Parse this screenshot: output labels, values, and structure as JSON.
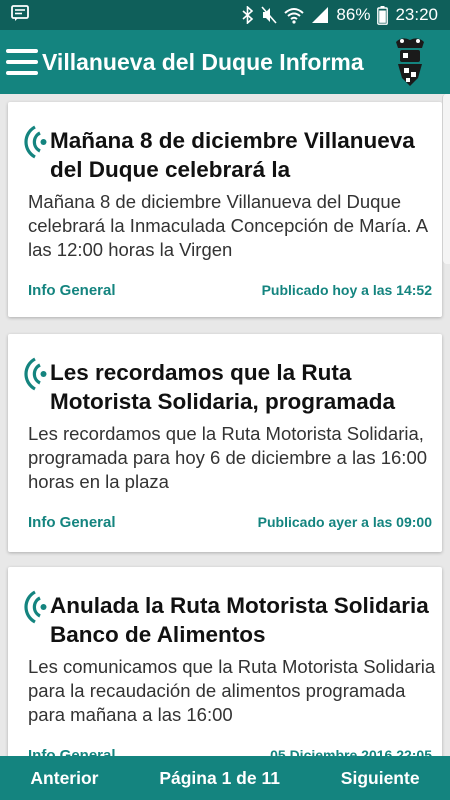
{
  "status_bar": {
    "battery": "86%",
    "time": "23:20"
  },
  "app_bar": {
    "title": "Villanueva del Duque Informa"
  },
  "posts": [
    {
      "title": "Mañana 8 de diciembre Villanueva del Duque celebrará la",
      "body": "Mañana 8 de diciembre Villanueva del Duque celebrará la Inmaculada Concepción de María. A las 12:00 horas la Virgen",
      "category": "Info General",
      "published": "Publicado hoy a las 14:52"
    },
    {
      "title": "Les recordamos que la Ruta Motorista Solidaria, programada",
      "body": "Les recordamos que la Ruta Motorista Solidaria, programada para hoy 6 de diciembre a las 16:00 horas en la plaza",
      "category": "Info General",
      "published": "Publicado ayer a las 09:00"
    },
    {
      "title": "Anulada la Ruta Motorista Solidaria Banco de Alimentos",
      "body": "Les comunicamos que la Ruta Motorista Solidaria para la recaudación de alimentos programada para mañana a las 16:00",
      "category": "Info General",
      "published": "05 Diciembre 2016 22:05"
    }
  ],
  "pagination": {
    "previous_label": "Anterior",
    "page_label": "Página 1 de 11",
    "next_label": "Siguiente"
  },
  "icons": {
    "menu": "hamburger-menu-icon",
    "logo": "town-logo",
    "post": "broadcast-signal-icon",
    "notification": "message-notification-icon",
    "bluetooth": "bluetooth-icon",
    "mute": "mute-icon",
    "wifi": "wifi-icon",
    "signal": "cell-signal-icon",
    "battery": "battery-icon"
  },
  "colors": {
    "accent": "#14847f",
    "status_bar": "#0f5f5a",
    "card_bg": "#ffffff",
    "page_bg": "#e8e8e8"
  }
}
